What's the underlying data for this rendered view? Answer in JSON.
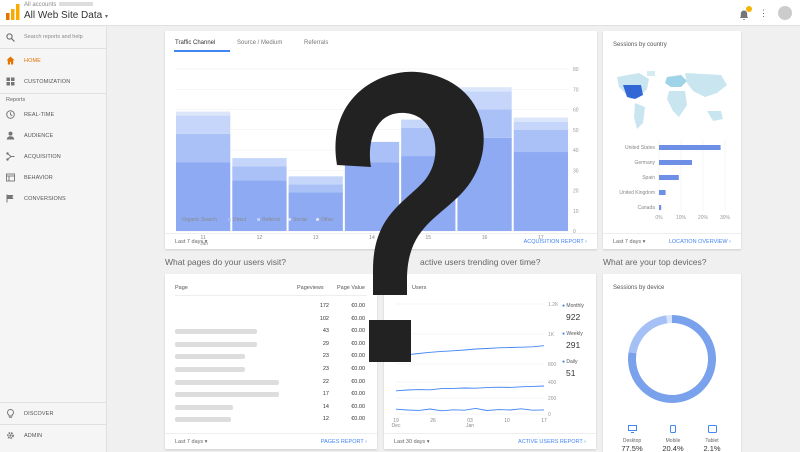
{
  "header": {
    "all_accounts": "All accounts",
    "view_name": "All Web Site Data"
  },
  "sidebar": {
    "search_placeholder": "Search reports and help",
    "home": "HOME",
    "customization": "CUSTOMIZATION",
    "reports_label": "Reports",
    "realtime": "REAL-TIME",
    "audience": "AUDIENCE",
    "acquisition": "ACQUISITION",
    "behavior": "BEHAVIOR",
    "conversions": "CONVERSIONS",
    "discover": "DISCOVER",
    "admin": "ADMIN"
  },
  "acquisition_card": {
    "tabs": [
      "Traffic Channel",
      "Source / Medium",
      "Referrals"
    ],
    "legend": [
      "Organic Search",
      "Direct",
      "Referral",
      "Social",
      "Other"
    ],
    "date_range": "Last 7 days",
    "report_link": "ACQUISITION REPORT"
  },
  "country_card": {
    "title": "Sessions by country",
    "date_range": "Last 7 days",
    "report_link": "LOCATION OVERVIEW"
  },
  "pages_section": {
    "title": "What pages do your users visit?",
    "col_page": "Page",
    "col_pageviews": "Pageviews",
    "col_value": "Page Value",
    "rows": [
      {
        "views": "172",
        "value": "€0.00"
      },
      {
        "views": "102",
        "value": "€0.00"
      },
      {
        "views": "43",
        "value": "€0.00"
      },
      {
        "views": "29",
        "value": "€0.00"
      },
      {
        "views": "23",
        "value": "€0.00"
      },
      {
        "views": "23",
        "value": "€0.00"
      },
      {
        "views": "22",
        "value": "€0.00"
      },
      {
        "views": "17",
        "value": "€0.00"
      },
      {
        "views": "14",
        "value": "€0.00"
      },
      {
        "views": "12",
        "value": "€0.00"
      }
    ],
    "date_range": "Last 7 days",
    "report_link": "PAGES REPORT"
  },
  "active_users_section": {
    "title": "active users trending over time?",
    "card_title": "Users",
    "metrics": [
      {
        "label": "Monthly",
        "value": "922",
        "color": "#4285f4"
      },
      {
        "label": "Weekly",
        "value": "291",
        "color": "#4285f4"
      },
      {
        "label": "Daily",
        "value": "51",
        "color": "#4285f4"
      }
    ],
    "date_range": "Last 30 days",
    "report_link": "ACTIVE USERS REPORT"
  },
  "devices_section": {
    "title": "What are your top devices?",
    "card_title": "Sessions by device",
    "devices": [
      {
        "name": "Desktop",
        "pct": "77.5%",
        "value": 77.5
      },
      {
        "name": "Mobile",
        "pct": "20.4%",
        "value": 20.4
      },
      {
        "name": "Tablet",
        "pct": "2.1%",
        "value": 2.1
      }
    ]
  },
  "chart_data": [
    {
      "type": "bar",
      "stacked": true,
      "categories": [
        "11",
        "12",
        "13",
        "14",
        "15",
        "16",
        "17"
      ],
      "x_sublabel_first": "Jan",
      "series": [
        {
          "name": "Organic Search",
          "values": [
            34,
            25,
            19,
            34,
            37,
            46,
            39
          ],
          "color": "#8eaaf2"
        },
        {
          "name": "Direct",
          "values": [
            14,
            7,
            4,
            10,
            14,
            14,
            11
          ],
          "color": "#a9c1f7"
        },
        {
          "name": "Referral",
          "values": [
            9,
            4,
            4,
            0,
            4,
            9,
            4
          ],
          "color": "#c5d6fa"
        },
        {
          "name": "Social",
          "values": [
            2,
            0,
            0,
            0,
            0,
            2,
            2
          ],
          "color": "#dbe6fb"
        }
      ],
      "y_ticks": [
        "0",
        "10",
        "20",
        "30",
        "40",
        "50",
        "60",
        "70",
        "80"
      ],
      "ylim": [
        0,
        80
      ]
    },
    {
      "type": "bar",
      "orientation": "horizontal",
      "categories": [
        "United States",
        "Germany",
        "Spain",
        "United Kingdom",
        "Canada"
      ],
      "values": [
        28,
        15,
        9,
        3,
        1
      ],
      "x_ticks": [
        "0%",
        "10%",
        "20%",
        "30%"
      ],
      "xlim": [
        0,
        30
      ]
    },
    {
      "type": "line",
      "series": [
        {
          "name": "Monthly",
          "values": [
            850,
            862,
            870,
            878,
            884,
            888,
            893,
            900,
            903,
            908,
            910,
            912,
            915,
            922
          ]
        },
        {
          "name": "Weekly",
          "values": [
            290,
            300,
            305,
            302,
            318,
            320,
            325,
            322,
            330,
            335,
            332,
            340,
            345,
            350
          ]
        },
        {
          "name": "Daily",
          "values": [
            60,
            50,
            45,
            62,
            40,
            52,
            48,
            70,
            44,
            55,
            50,
            65,
            47,
            51
          ]
        }
      ],
      "x_labels": [
        "19",
        "26",
        "03",
        "10",
        "17"
      ],
      "x_sublabel": "Dec",
      "x_sublabel2": "Jan",
      "y_ticks_upper": [
        "1.2K",
        "1K",
        "800"
      ],
      "y_ticks_lower": [
        "400",
        "200",
        "0"
      ]
    },
    {
      "type": "pie",
      "donut": true,
      "categories": [
        "Desktop",
        "Mobile",
        "Tablet"
      ],
      "values": [
        77.5,
        20.4,
        2.1
      ]
    }
  ]
}
